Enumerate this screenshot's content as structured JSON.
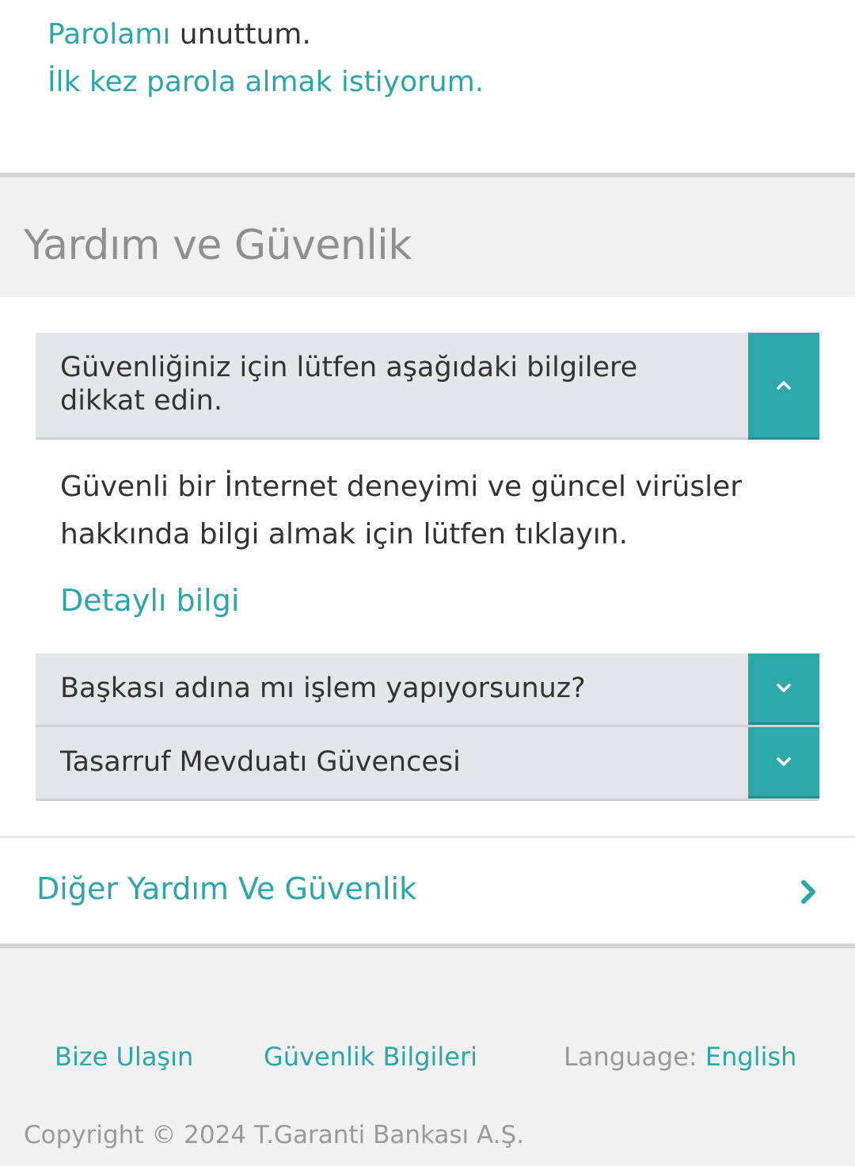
{
  "top": {
    "forgot_link": "Parolamı",
    "forgot_suffix": " unuttum.",
    "first_time": "İlk kez parola almak istiyorum."
  },
  "section": {
    "title": "Yardım ve Güvenlik"
  },
  "accordion": [
    {
      "title_line1": "Güvenliğiniz için lütfen aşağıdaki bilgilere",
      "title_line2": "dikkat edin.",
      "expanded": true,
      "body_line1": "Güvenli bir İnternet deneyimi ve güncel virüsler",
      "body_line2": "hakkında bilgi almak için lütfen tıklayın.",
      "link": "Detaylı bilgi"
    },
    {
      "title": "Başkası adına mı işlem yapıyorsunuz?",
      "expanded": false
    },
    {
      "title": "Tasarruf Mevduatı Güvencesi",
      "expanded": false
    }
  ],
  "other": {
    "label": "Diğer Yardım Ve Güvenlik",
    "icon": "chevron-right-icon"
  },
  "footer": {
    "contact": "Bize Ulaşın",
    "security": "Güvenlik Bilgileri",
    "language_label": "Language: ",
    "language_value": "English",
    "copyright": "Copyright © 2024 T.Garanti Bankası A.Ş."
  },
  "colors": {
    "accent": "#2ca6a8",
    "toggle_bg": "#2ea9aa",
    "panel_bg": "#e5e6e9",
    "section_bg": "#f1f1f1"
  }
}
